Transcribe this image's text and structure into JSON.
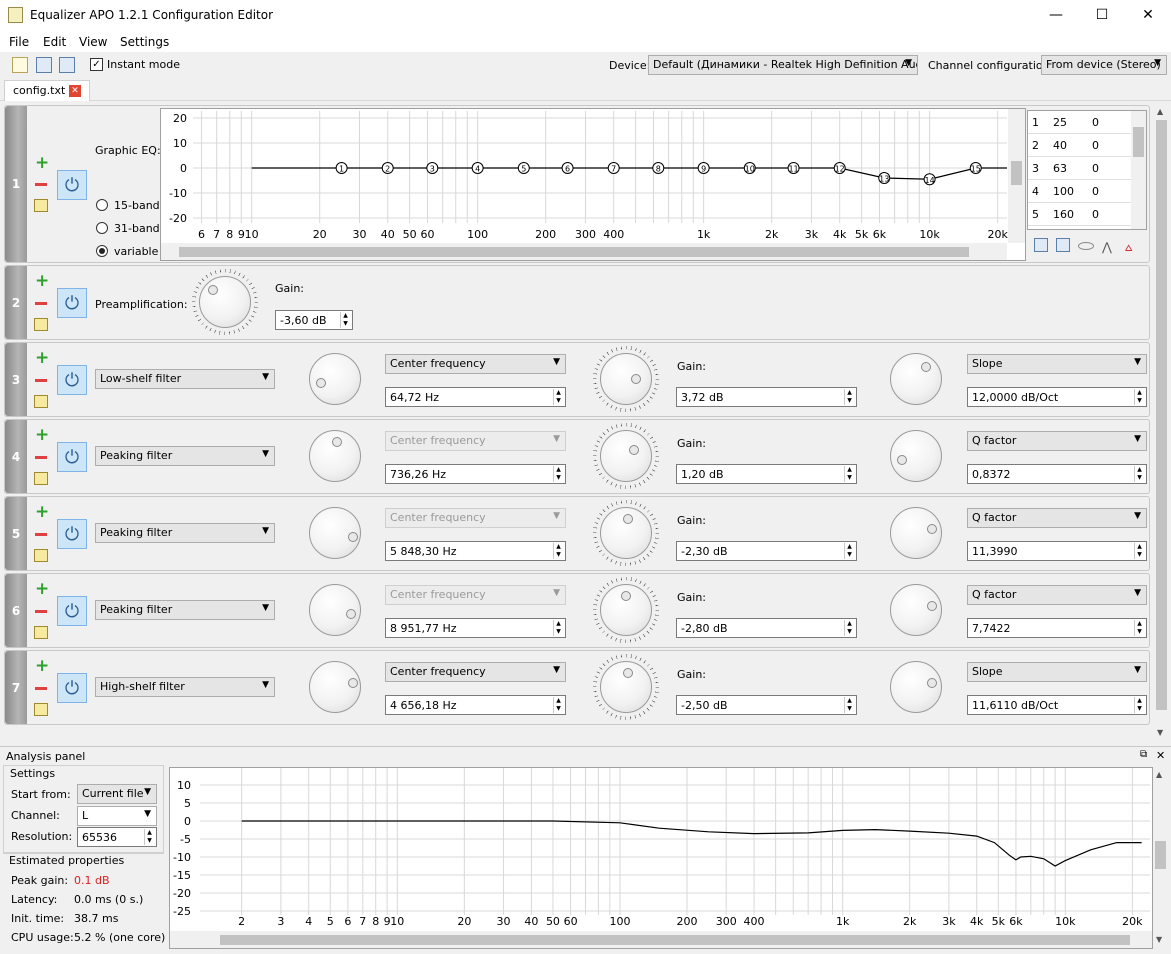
{
  "window": {
    "title": "Equalizer APO 1.2.1 Configuration Editor",
    "minimize": "—",
    "maximize": "☐",
    "close": "✕"
  },
  "menu": [
    "File",
    "Edit",
    "View",
    "Settings"
  ],
  "toolbar": {
    "instant_mode": "Instant mode",
    "instant_mode_checked": true,
    "device_label": "Device:",
    "device_value": "Default (Динамики - Realtek High Definition Audio)",
    "channel_label": "Channel configuration:",
    "channel_value": "From device (Stereo)"
  },
  "tab": {
    "label": "config.txt",
    "close": "✕"
  },
  "rows": [
    {
      "index": "1",
      "type": "graphic_eq",
      "label": "Graphic EQ:",
      "modes": [
        "15-band",
        "31-band",
        "variable"
      ],
      "selected_mode": "variable",
      "y_ticks": [
        "20",
        "10",
        "0",
        "-10",
        "-20"
      ],
      "x_ticks": [
        "6",
        "7",
        "8",
        "9",
        "10",
        "20",
        "30",
        "40",
        "50",
        "60",
        "100",
        "200",
        "300",
        "400",
        "1k",
        "2k",
        "3k",
        "4k",
        "5k",
        "6k",
        "10k",
        "20k"
      ],
      "band_points": [
        {
          "n": "1",
          "f": 25,
          "g": 0
        },
        {
          "n": "2",
          "f": 40,
          "g": 0
        },
        {
          "n": "3",
          "f": 63,
          "g": 0
        },
        {
          "n": "4",
          "f": 100,
          "g": 0
        },
        {
          "n": "5",
          "f": 160,
          "g": 0
        },
        {
          "n": "6",
          "f": 250,
          "g": 0
        },
        {
          "n": "7",
          "f": 400,
          "g": 0
        },
        {
          "n": "8",
          "f": 630,
          "g": 0
        },
        {
          "n": "9",
          "f": 1000,
          "g": 0
        },
        {
          "n": "10",
          "f": 1600,
          "g": 0
        },
        {
          "n": "11",
          "f": 2500,
          "g": 0
        },
        {
          "n": "12",
          "f": 4000,
          "g": 0
        },
        {
          "n": "13",
          "f": 6300,
          "g": -4
        },
        {
          "n": "14",
          "f": 10000,
          "g": -4.5
        },
        {
          "n": "15",
          "f": 16000,
          "g": 0
        }
      ],
      "table": [
        {
          "n": "1",
          "freq": "25",
          "gain": "0"
        },
        {
          "n": "2",
          "freq": "40",
          "gain": "0"
        },
        {
          "n": "3",
          "freq": "63",
          "gain": "0"
        },
        {
          "n": "4",
          "freq": "100",
          "gain": "0"
        },
        {
          "n": "5",
          "freq": "160",
          "gain": "0"
        }
      ]
    },
    {
      "index": "2",
      "type": "preamp",
      "label": "Preamplification:",
      "gain_label": "Gain:",
      "gain_value": "-3,60 dB"
    },
    {
      "index": "3",
      "filter": "Low-shelf filter",
      "freq_mode": "Center frequency",
      "freq_mode_enabled": true,
      "freq_value": "64,72 Hz",
      "gain_label": "Gain:",
      "gain_value": "3,72 dB",
      "param_mode": "Slope",
      "param_value": "12,0000 dB/Oct"
    },
    {
      "index": "4",
      "filter": "Peaking filter",
      "freq_mode": "Center frequency",
      "freq_mode_enabled": false,
      "freq_value": "736,26 Hz",
      "gain_label": "Gain:",
      "gain_value": "1,20 dB",
      "param_mode": "Q factor",
      "param_value": "0,8372"
    },
    {
      "index": "5",
      "filter": "Peaking filter",
      "freq_mode": "Center frequency",
      "freq_mode_enabled": false,
      "freq_value": "5 848,30 Hz",
      "gain_label": "Gain:",
      "gain_value": "-2,30 dB",
      "param_mode": "Q factor",
      "param_value": "11,3990"
    },
    {
      "index": "6",
      "filter": "Peaking filter",
      "freq_mode": "Center frequency",
      "freq_mode_enabled": false,
      "freq_value": "8 951,77 Hz",
      "gain_label": "Gain:",
      "gain_value": "-2,80 dB",
      "param_mode": "Q factor",
      "param_value": "7,7422"
    },
    {
      "index": "7",
      "filter": "High-shelf filter",
      "freq_mode": "Center frequency",
      "freq_mode_enabled": true,
      "freq_value": "4 656,18 Hz",
      "gain_label": "Gain:",
      "gain_value": "-2,50 dB",
      "param_mode": "Slope",
      "param_value": "11,6110 dB/Oct"
    }
  ],
  "analysis": {
    "title": "Analysis panel",
    "settings_title": "Settings",
    "start_from_label": "Start from:",
    "start_from_value": "Current file",
    "channel_label": "Channel:",
    "channel_value": "L",
    "resolution_label": "Resolution:",
    "resolution_value": "65536",
    "estimated_title": "Estimated properties",
    "peak_gain_label": "Peak gain:",
    "peak_gain_value": "0.1 dB",
    "peak_gain_color": "#e02020",
    "latency_label": "Latency:",
    "latency_value": "0.0 ms (0 s.)",
    "init_label": "Init. time:",
    "init_value": "38.7 ms",
    "cpu_label": "CPU usage:",
    "cpu_value": "5.2 % (one core)",
    "y_ticks": [
      "10",
      "5",
      "0",
      "-5",
      "-10",
      "-15",
      "-20",
      "-25"
    ],
    "x_ticks": [
      "2",
      "3",
      "4",
      "5",
      "6",
      "7",
      "8",
      "9",
      "10",
      "20",
      "30",
      "40",
      "50",
      "60",
      "100",
      "200",
      "300",
      "400",
      "1k",
      "2k",
      "3k",
      "4k",
      "5k",
      "6k",
      "10k",
      "20k"
    ],
    "response": [
      {
        "f": 2,
        "g": 0
      },
      {
        "f": 50,
        "g": 0
      },
      {
        "f": 100,
        "g": -0.5
      },
      {
        "f": 150,
        "g": -2
      },
      {
        "f": 250,
        "g": -3
      },
      {
        "f": 400,
        "g": -3.5
      },
      {
        "f": 700,
        "g": -3.3
      },
      {
        "f": 1000,
        "g": -2.6
      },
      {
        "f": 1400,
        "g": -2.4
      },
      {
        "f": 2000,
        "g": -2.8
      },
      {
        "f": 3000,
        "g": -3.4
      },
      {
        "f": 4000,
        "g": -4.2
      },
      {
        "f": 4800,
        "g": -6
      },
      {
        "f": 5600,
        "g": -9.5
      },
      {
        "f": 6000,
        "g": -10.8
      },
      {
        "f": 6300,
        "g": -10
      },
      {
        "f": 7000,
        "g": -9.8
      },
      {
        "f": 8000,
        "g": -10.5
      },
      {
        "f": 9000,
        "g": -12.5
      },
      {
        "f": 10000,
        "g": -11
      },
      {
        "f": 13000,
        "g": -8
      },
      {
        "f": 17000,
        "g": -6
      },
      {
        "f": 22000,
        "g": -6
      }
    ]
  }
}
